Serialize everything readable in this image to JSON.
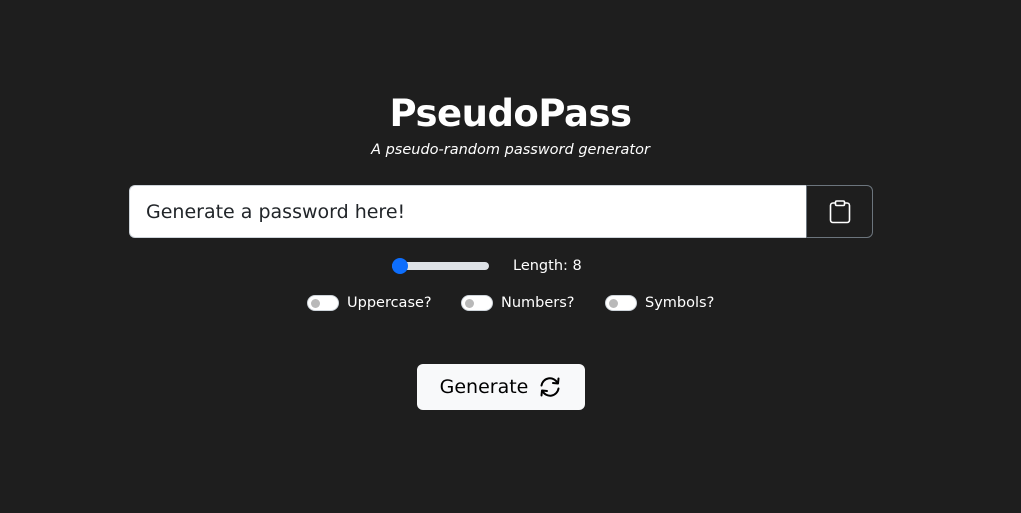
{
  "app": {
    "title": "PseudoPass",
    "subtitle": "A pseudo-random password generator"
  },
  "password": {
    "value": "",
    "placeholder": "Generate a password here!"
  },
  "copy_button": {
    "icon": "clipboard-icon"
  },
  "length": {
    "label": "Length: 8",
    "value": 8,
    "min": 8,
    "max": 64
  },
  "options": [
    {
      "label": "Uppercase?",
      "checked": false
    },
    {
      "label": "Numbers?",
      "checked": false
    },
    {
      "label": "Symbols?",
      "checked": false
    }
  ],
  "generate_button": {
    "label": "Generate",
    "icon": "refresh-icon"
  },
  "colors": {
    "background": "#1e1e1e",
    "accent": "#0d6efd",
    "button_light": "#f8f9fa"
  }
}
